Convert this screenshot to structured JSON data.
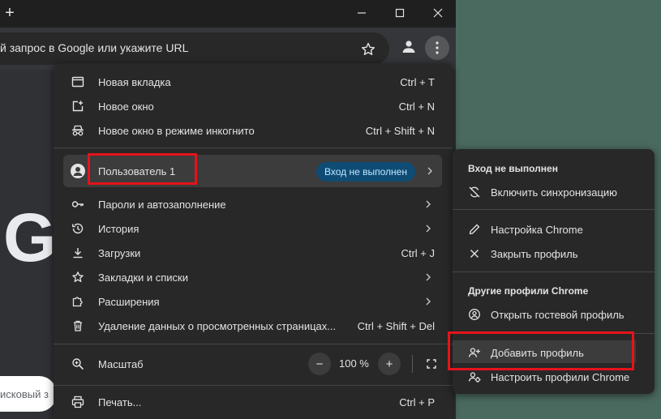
{
  "window": {
    "new_tab_glyph": "+",
    "minimize_icon": "minimize-icon",
    "maximize_icon": "maximize-icon",
    "close_icon": "close-icon"
  },
  "omnibox": {
    "text": "й запрос в Google или укажите URL"
  },
  "page": {
    "logo_fragment": "G",
    "search_fragment": "исковый з"
  },
  "menu": {
    "new_tab": {
      "label": "Новая вкладка",
      "shortcut": "Ctrl + T",
      "icon": "new-tab-icon"
    },
    "new_window": {
      "label": "Новое окно",
      "shortcut": "Ctrl + N",
      "icon": "new-window-icon"
    },
    "incognito": {
      "label": "Новое окно в режиме инкогнито",
      "shortcut": "Ctrl + Shift + N",
      "icon": "incognito-icon"
    },
    "profile": {
      "label": "Пользователь 1",
      "badge": "Вход не выполнен",
      "icon": "person-icon"
    },
    "passwords": {
      "label": "Пароли и автозаполнение",
      "icon": "key-icon"
    },
    "history": {
      "label": "История",
      "icon": "history-icon"
    },
    "downloads": {
      "label": "Загрузки",
      "shortcut": "Ctrl + J",
      "icon": "download-icon"
    },
    "bookmarks": {
      "label": "Закладки и списки",
      "icon": "star-icon"
    },
    "extensions": {
      "label": "Расширения",
      "icon": "puzzle-icon"
    },
    "clear_data": {
      "label": "Удаление данных о просмотренных страницах...",
      "shortcut": "Ctrl + Shift + Del",
      "icon": "trash-icon"
    },
    "zoom": {
      "label": "Масштаб",
      "value": "100 %",
      "minus": "−",
      "plus": "+",
      "icon": "zoom-icon"
    },
    "print": {
      "label": "Печать...",
      "shortcut": "Ctrl + P",
      "icon": "print-icon"
    }
  },
  "submenu": {
    "signed_out_header": "Вход не выполнен",
    "enable_sync": "Включить синхронизацию",
    "customize_chrome": "Настройка Chrome",
    "close_profile": "Закрыть профиль",
    "other_profiles_header": "Другие профили Chrome",
    "guest_profile": "Открыть гостевой профиль",
    "add_profile": "Добавить профиль",
    "manage_profiles": "Настроить профили Chrome"
  },
  "colors": {
    "menu_bg": "#282828",
    "highlight": "#3c3c3c",
    "badge_bg": "#0f4c75",
    "annotation_red": "#e5131b"
  }
}
